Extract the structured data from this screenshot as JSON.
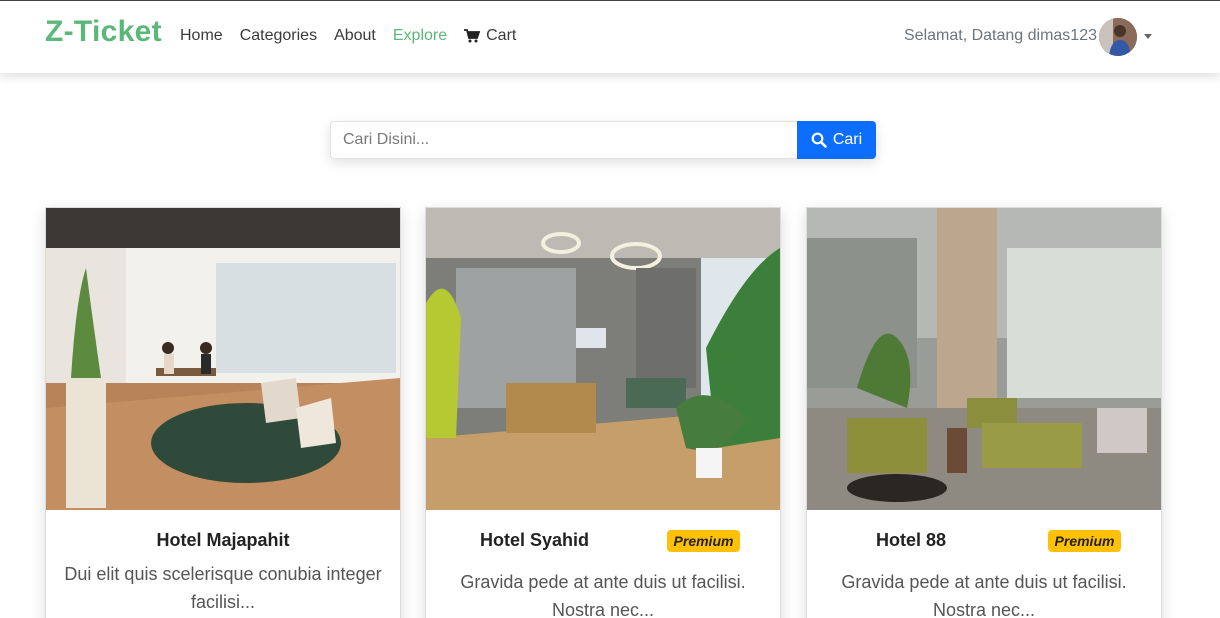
{
  "brand": "Z-Ticket",
  "nav": {
    "items": [
      {
        "label": "Home"
      },
      {
        "label": "Categories"
      },
      {
        "label": "About"
      },
      {
        "label": "Explore"
      },
      {
        "label": "Cart"
      }
    ],
    "active_color": "#5cb87a"
  },
  "user": {
    "greeting": "Selamat, Datang dimas123"
  },
  "search": {
    "placeholder": "Cari Disini...",
    "button_label": "Cari"
  },
  "cards": [
    {
      "title": "Hotel Majapahit",
      "badge": "",
      "description": "Dui elit quis scelerisque conubia integer facilisi..."
    },
    {
      "title": "Hotel Syahid",
      "badge": "Premium",
      "description": "Gravida pede at ante duis ut facilisi. Nostra nec..."
    },
    {
      "title": "Hotel 88",
      "badge": "Premium",
      "description": "Gravida pede at ante duis ut facilisi. Nostra nec..."
    }
  ],
  "colors": {
    "brand": "#5cb87a",
    "primary": "#0d6efd",
    "badge": "#ffc107"
  }
}
